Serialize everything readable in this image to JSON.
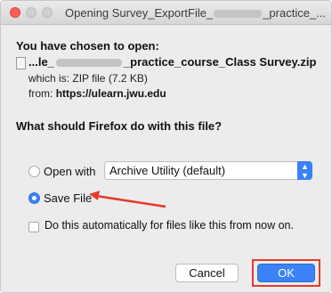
{
  "window": {
    "title_prefix": "Opening Survey_ExportFile_",
    "title_suffix": "_practice_..."
  },
  "download": {
    "heading": "You have chosen to open:",
    "file_prefix": "...le_",
    "file_suffix": "_practice_course_Class Survey.zip",
    "type_label": "which is:",
    "type_value": "ZIP file (7.2 KB)",
    "from_label": "from:",
    "from_value": "https://ulearn.jwu.edu"
  },
  "action": {
    "question": "What should Firefox do with this file?",
    "open_with_label": "Open with",
    "open_with_app": "Archive Utility (default)",
    "save_label": "Save File",
    "selected": "save",
    "auto_label": "Do this automatically for files like this from now on."
  },
  "buttons": {
    "cancel": "Cancel",
    "ok": "OK"
  },
  "colors": {
    "accent": "#3b82f6",
    "annotation": "#e53b2c"
  }
}
